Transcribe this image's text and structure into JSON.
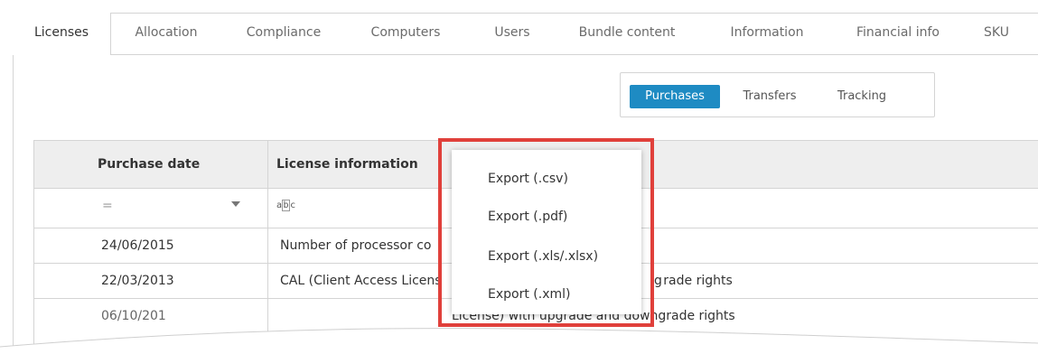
{
  "tabs": [
    {
      "label": "Licenses",
      "active": true
    },
    {
      "label": "Allocation"
    },
    {
      "label": "Compliance"
    },
    {
      "label": "Computers"
    },
    {
      "label": "Users"
    },
    {
      "label": "Bundle content"
    },
    {
      "label": "Information"
    },
    {
      "label": "Financial info"
    },
    {
      "label": "SKU"
    }
  ],
  "segment": {
    "purchases": "Purchases",
    "transfers": "Transfers",
    "tracking": "Tracking",
    "active": "Purchases"
  },
  "grid": {
    "columns": {
      "purchase_date": "Purchase date",
      "license_information": "License information"
    },
    "filter": {
      "date_operator": "=",
      "text_icon": "abc-filter-icon"
    },
    "rows": [
      {
        "date": "24/06/2015",
        "info": "Number of processor co"
      },
      {
        "date": "22/03/2013",
        "info": "CAL (Client Access Licens",
        "info_tail": "g rade rights"
      },
      {
        "date": "06/10/201",
        "info": "License) with upgrade and downgrade rights"
      }
    ]
  },
  "context_menu": {
    "items": [
      "Export (.csv)",
      "Export (.pdf)",
      "Export (.xls/.xlsx)",
      "Export (.xml)"
    ]
  },
  "colors": {
    "accent": "#1e8bc3",
    "highlight": "#e0403b",
    "header_bg": "#eeeeee",
    "border": "#d4d4d4"
  }
}
